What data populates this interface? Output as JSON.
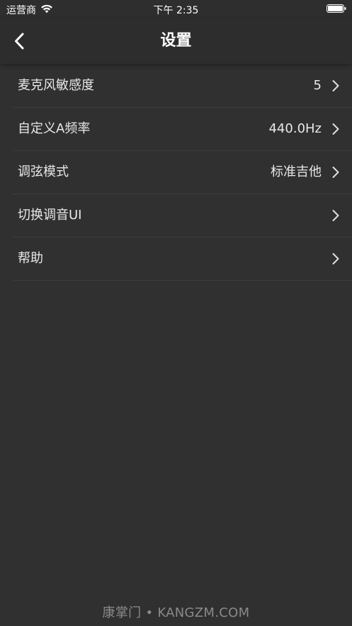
{
  "status_bar": {
    "carrier": "运营商",
    "time": "下午 2:35",
    "wifi_icon": "wifi-icon",
    "battery_icon": "battery-icon"
  },
  "nav": {
    "title": "设置",
    "back_icon": "chevron-left-icon"
  },
  "settings": [
    {
      "label": "麦克风敏感度",
      "value": "5"
    },
    {
      "label": "自定义A频率",
      "value": "440.0Hz"
    },
    {
      "label": "调弦模式",
      "value": "标准吉他"
    },
    {
      "label": "切换调音UI",
      "value": ""
    },
    {
      "label": "帮助",
      "value": ""
    }
  ],
  "watermark": "康掌门 • KANGZM.COM",
  "colors": {
    "background": "#303030",
    "navbar": "#2d2d2d",
    "text": "#e8e8e8",
    "divider": "#3c3c3c",
    "watermark": "#8a8a8a"
  }
}
